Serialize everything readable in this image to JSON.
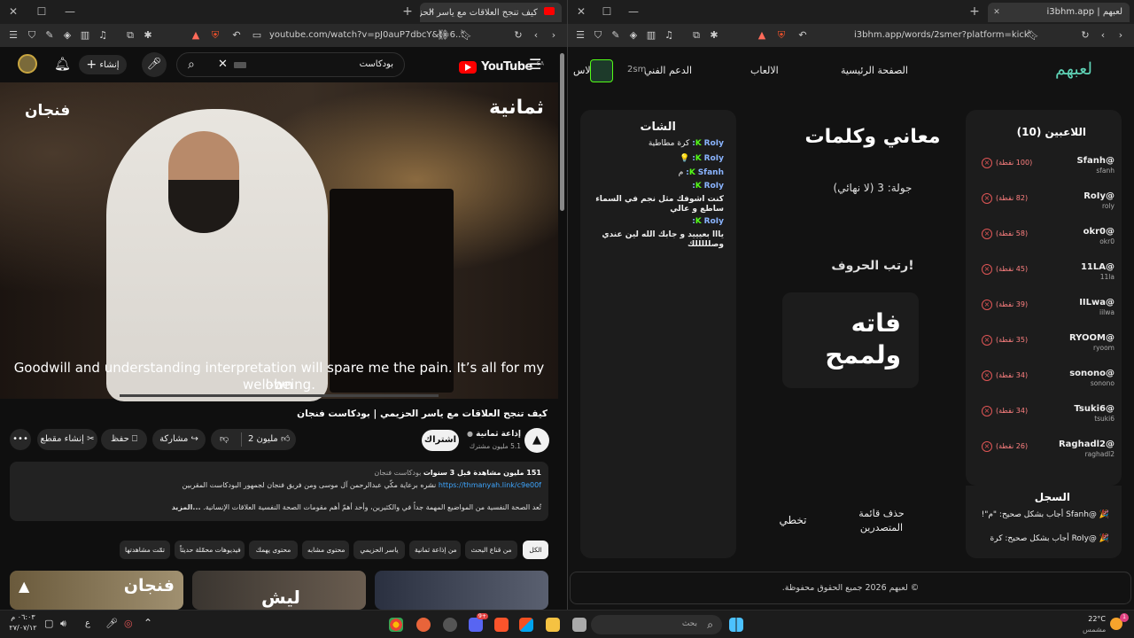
{
  "left_window": {
    "tab_title": "كيف تنجح العلاقات مع ياسر الحز",
    "url": "youtube.com/watch?v=pJ0auP7dbcY&t=6...",
    "youtube": {
      "logo": "YouTube",
      "logo_region": "SA",
      "search_value": "بودكاست",
      "create_label": "إنشاء",
      "video": {
        "watermark_left": "فنجان",
        "watermark_right": "ثمانية",
        "subtitle_line1": "Goodwill and understanding interpretation will spare me the pain. It’s all for my own",
        "subtitle_line2": "well-being."
      },
      "title": "كيف تنجح العلاقات مع ياسر الحزيمي | بودكاست فنجان",
      "channel_name": "إذاعة ثمانية",
      "channel_subs": "5.1 مليون مشترك",
      "subscribe_label": "اشتراك",
      "likes": "2 مليون",
      "share_label": "مشاركة",
      "save_label": "حفظ",
      "clip_label": "إنشاء مقطع",
      "description": {
        "stats": "151 مليون مشاهدة  قبل 3 سنوات",
        "tag": "بودكاست فنجان",
        "line2_prefix": "نشره برعاية مكّي عبدالرحمن آل موسى ومن فريق فنجان لجمهور البودكاست المقربين",
        "link": "https://thmanyah.link/c9e00f",
        "line3": "تُعد الصحة النفسية من المواضيع المهمة جداً في والكثيرين، وأحد أهمّ أهم مقومات الصحة النفسية العلاقات الإنسانية.",
        "more": "...المزيد"
      },
      "chips": [
        "الكل",
        "من قناع البحث",
        "من إذاعة ثمانية",
        "ياسر الحزيمي",
        "محتوى مشابه",
        "محتوى يهمك",
        "فيديوهات محمّلة حديثاً",
        "تمّت مشاهدتها"
      ],
      "thumbnails": [
        {
          "text": "فنجان"
        },
        {
          "text": "ليش"
        },
        {
          "text": ""
        }
      ]
    }
  },
  "right_window": {
    "tab_title": "لعبهم | i3bhm.app",
    "url": "i3bhm.app/words/2smer?platform=kick",
    "site": {
      "logo": "لعبهم",
      "nav": [
        "الصفحة الرئيسية",
        "الالعاب",
        "الدعم الفني",
        "الاس"
      ],
      "user_handle": "2sm",
      "players_title": "اللاعبين (10)",
      "players": [
        {
          "name": "@Sfanh",
          "user": "sfanh",
          "points": "(100 نقطة)"
        },
        {
          "name": "@RoIy",
          "user": "roly",
          "points": "(82 نقطة)"
        },
        {
          "name": "@okr0",
          "user": "okr0",
          "points": "(58 نقطة)"
        },
        {
          "name": "@11LA",
          "user": "11la",
          "points": "(45 نقطة)"
        },
        {
          "name": "@IILwa",
          "user": "iilwa",
          "points": "(39 نقطة)"
        },
        {
          "name": "@RYOOM",
          "user": "ryoom",
          "points": "(35 نقطة)"
        },
        {
          "name": "@sonono",
          "user": "sonono",
          "points": "(34 نقطة)"
        },
        {
          "name": "@Tsuki6",
          "user": "tsuki6",
          "points": "(34 نقطة)"
        },
        {
          "name": "@Raghadl2",
          "user": "raghadl2",
          "points": "(26 نقطة)"
        }
      ],
      "game_title": "معاني وكلمات",
      "round": "جولة: 3 (لا نهائي)",
      "instruction": "رتب الحروف!",
      "scrambled_line1": "فاته",
      "scrambled_line2": "ولممح",
      "delete_leaderboard": "حذف قائمة المتصدرين",
      "skip": "تخطي",
      "chat_title": "الشات",
      "chat": [
        {
          "user": "RoIy:",
          "text": "كرة مطاطية"
        },
        {
          "user": "RoIy:",
          "text": "💡"
        },
        {
          "user": "Sfanh:",
          "text": "م"
        },
        {
          "user": "RoIy:",
          "text": ""
        },
        {
          "user": "",
          "text": "كنت اشوفك مثل نجم في السماء"
        },
        {
          "user": "",
          "text": "ساطع و عالي"
        },
        {
          "user": "RoIy:",
          "text": ""
        },
        {
          "user": "",
          "text": "يااا بعيييد و جابك الله لين عندي"
        },
        {
          "user": "",
          "text": "وصلللللك"
        }
      ],
      "log_title": "السجل",
      "log": [
        "🎉 @Sfanh أجاب بشكل صحيح: \"م\"!",
        "🎉 @RoIy أجاب بشكل صحيح: كرة"
      ],
      "footer": "© لعبهم 2026 جميع الحقوق محفوظة."
    }
  },
  "taskbar": {
    "search_placeholder": "بحث",
    "weather_temp": "22°C",
    "weather_desc": "مشمس",
    "time": "٠٦:٠٣ م",
    "date": "٢٧/٠٧/١٢",
    "lang": "ع",
    "notif_count": "1"
  },
  "colors": {
    "youtube_red": "#ff0000",
    "kick_green": "#53fc18",
    "points_red": "#ff8080",
    "logo_teal": "#5fd3b6"
  }
}
